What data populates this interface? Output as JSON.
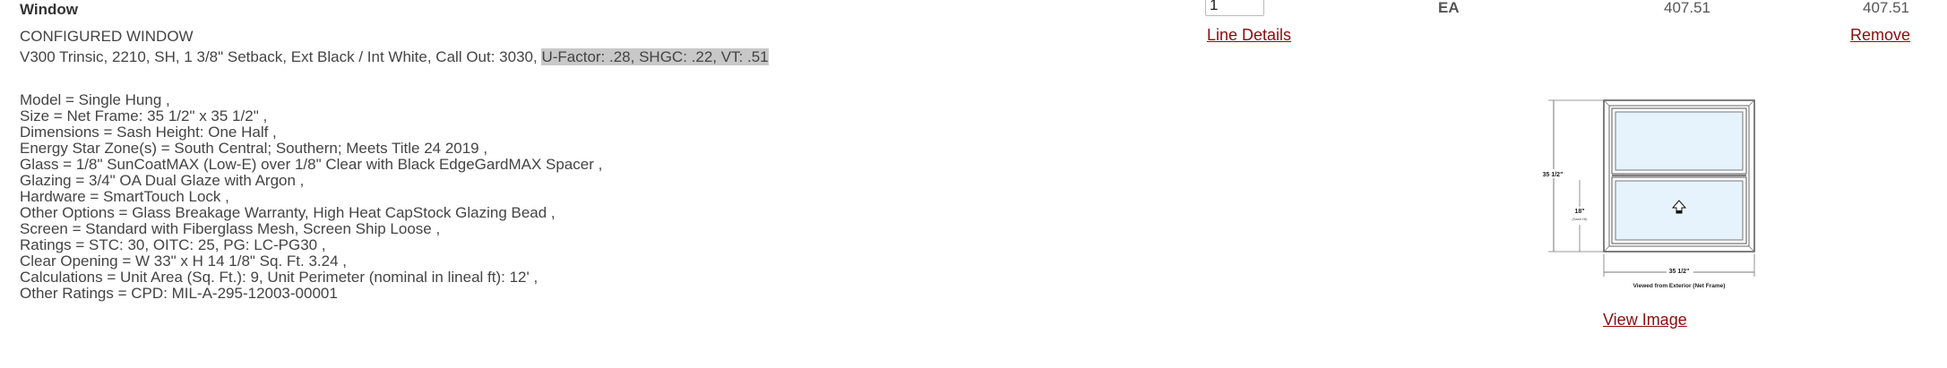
{
  "item": {
    "title": "Window",
    "configured_heading": "CONFIGURED WINDOW",
    "description_main": "V300 Trinsic, 2210, SH, 1 3/8\" Setback, Ext Black / Int White, Call Out: 3030, ",
    "description_highlight": "U-Factor: .28, SHGC: .22, VT: .51",
    "options": [
      "Model = Single Hung  ,",
      "Size = Net Frame: 35 1/2\" x 35 1/2\"  ,",
      "Dimensions = Sash Height: One Half  ,",
      "Energy Star Zone(s) = South Central; Southern; Meets Title 24 2019  ,",
      "Glass = 1/8\" SunCoatMAX (Low-E) over 1/8\" Clear with Black EdgeGardMAX Spacer  ,",
      "Glazing = 3/4\" OA Dual Glaze with Argon  ,",
      "Hardware = SmartTouch Lock  ,",
      "Other Options = Glass Breakage Warranty, High Heat CapStock Glazing Bead  ,",
      "Screen = Standard with Fiberglass Mesh, Screen Ship Loose  ,",
      "Ratings = STC: 30, OITC: 25, PG: LC-PG30  ,",
      "Clear Opening = W 33\" x H 14 1/8\" Sq. Ft. 3.24  ,",
      "Calculations = Unit Area (Sq. Ft.): 9, Unit Perimeter (nominal in lineal ft): 12'  ,",
      "Other Ratings = CPD: MIL-A-295-12003-00001"
    ],
    "quantity": "1",
    "unit": "EA",
    "unit_price": "407.51",
    "extended_price": "407.51",
    "line_details_label": "Line Details",
    "remove_label": "Remove",
    "view_image_label": "View Image"
  },
  "drawing": {
    "height_label": "35 1/2\"",
    "sash_label": "18\"",
    "sash_sublabel": "(Sash Ht)",
    "width_label": "35 1/2\"",
    "caption": "Viewed from Exterior (Net Frame)",
    "glass_color": "#e6f2fc",
    "frame_color": "#555555"
  },
  "colors": {
    "link": "#8b0d0d",
    "highlight": "#c8c8c8"
  }
}
